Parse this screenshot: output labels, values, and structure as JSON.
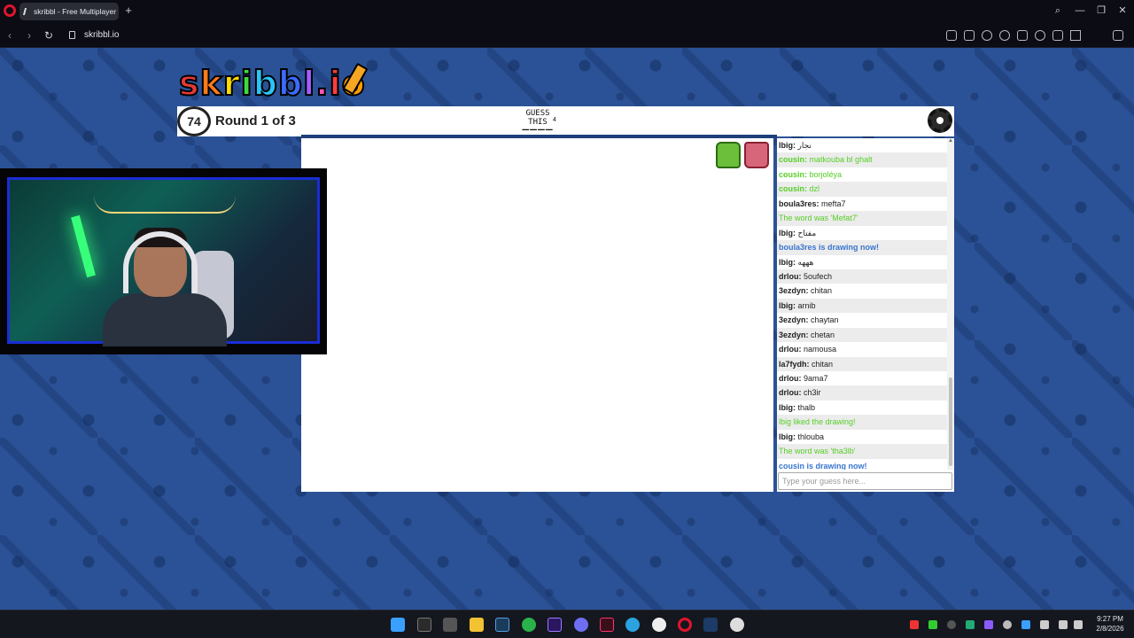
{
  "browser": {
    "tab_title": "skribbl - Free Multiplayer",
    "newtab_label": "+",
    "url": "skribbl.io"
  },
  "game": {
    "logo_letters": [
      "s",
      "k",
      "r",
      "i",
      "b",
      "b",
      "l",
      ".",
      "i",
      "o",
      "!"
    ],
    "logo_colors": [
      "#e53935",
      "#ff7a1a",
      "#ffdd00",
      "#3ddc3d",
      "#29c5f6",
      "#3a6cff",
      "#a55cff",
      "#ff57b2",
      "#ff3d3d",
      "#ff9d00",
      "#ffd600"
    ],
    "timer": "74",
    "round_text": "Round 1 of 3",
    "guess_label": "GUESS THIS",
    "word_hint": "____",
    "word_length": "4",
    "chat_input_placeholder": "Type your guess here..."
  },
  "chat": [
    {
      "name": "lbig:",
      "text": "نجار",
      "style": "normal"
    },
    {
      "name": "cousin:",
      "text": "matkouba bl ghalt",
      "style": "greenname"
    },
    {
      "name": "cousin:",
      "text": "borjoléya",
      "style": "greenname"
    },
    {
      "name": "cousin:",
      "text": "dzl",
      "style": "greenname"
    },
    {
      "name": "boula3res:",
      "text": "mefta7",
      "style": "normal"
    },
    {
      "name": "",
      "text": "The word was 'Mefat7'",
      "style": "green"
    },
    {
      "name": "lbig:",
      "text": "مفتاح",
      "style": "normal"
    },
    {
      "name": "",
      "text": "boula3res is drawing now!",
      "style": "blue"
    },
    {
      "name": "lbig:",
      "text": "هههه",
      "style": "normal"
    },
    {
      "name": "drlou:",
      "text": "5oufech",
      "style": "normal"
    },
    {
      "name": "3ezdyn:",
      "text": "chitan",
      "style": "normal"
    },
    {
      "name": "lbig:",
      "text": "arnib",
      "style": "normal"
    },
    {
      "name": "3ezdyn:",
      "text": "chaytan",
      "style": "normal"
    },
    {
      "name": "3ezdyn:",
      "text": "chetan",
      "style": "normal"
    },
    {
      "name": "drlou:",
      "text": "namousa",
      "style": "normal"
    },
    {
      "name": "la7fydh:",
      "text": "chitan",
      "style": "normal"
    },
    {
      "name": "drlou:",
      "text": "9ama7",
      "style": "normal"
    },
    {
      "name": "drlou:",
      "text": "ch3ir",
      "style": "normal"
    },
    {
      "name": "lbig:",
      "text": "thalb",
      "style": "normal"
    },
    {
      "name": "",
      "text": "lbig liked the drawing!",
      "style": "green"
    },
    {
      "name": "lbig:",
      "text": "thlouba",
      "style": "normal"
    },
    {
      "name": "",
      "text": "The word was 'tha3lb'",
      "style": "green"
    },
    {
      "name": "",
      "text": "cousin is drawing now!",
      "style": "blue"
    }
  ],
  "taskbar": {
    "time": "9:27 PM",
    "date": "2/8/2026"
  }
}
